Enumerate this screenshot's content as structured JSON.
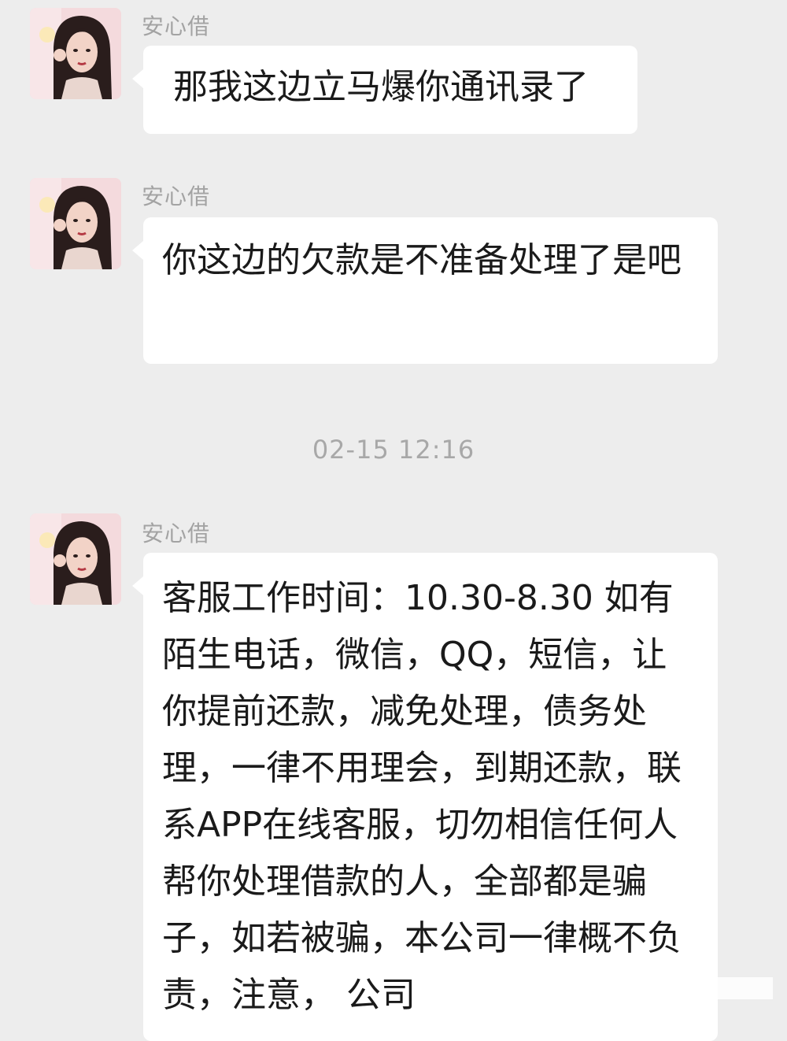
{
  "messages": [
    {
      "sender": "安心借",
      "text": "那我这边立马爆你通讯录了"
    },
    {
      "sender": "安心借",
      "text": " 你这边的欠款是不准备处理了是吧"
    },
    {
      "sender": "安心借",
      "text": "客服工作时间：10.30-8.30 如有陌生电话，微信，QQ，短信，让你提前还款，减免处理，债务处理，一律不用理会，到期还款，联系APP在线客服，切勿相信任何人帮你处理借款的人，全部都是骗子，如若被骗，本公司一律概不负责，注意，   公司"
    }
  ],
  "timestamp": "02-15 12:16",
  "colors": {
    "background": "#ededed",
    "bubble": "#ffffff",
    "sender_text": "#a3a3a3",
    "timestamp_text": "#a8a8a8"
  },
  "avatar_icon": "profile-photo-avatar"
}
